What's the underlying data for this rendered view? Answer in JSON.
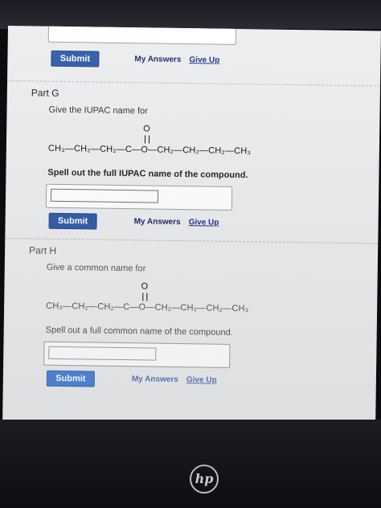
{
  "top": {
    "submit_label": "Submit",
    "my_answers_label": "My Answers",
    "give_up_label": "Give Up"
  },
  "part_g": {
    "title": "Part G",
    "prompt": "Give the IUPAC name for",
    "carbonyl": "O",
    "formula": "CH₃—CH₂—CH₂—C—O—CH₂—CH₂—CH₂—CH₃",
    "instruction": "Spell out the full IUPAC name of the compound.",
    "answer_value": "",
    "submit_label": "Submit",
    "my_answers_label": "My Answers",
    "give_up_label": "Give Up"
  },
  "part_h": {
    "title": "Part H",
    "prompt": "Give a common name for",
    "carbonyl": "O",
    "formula": "CH₃—CH₂—CH₂—C—O—CH₂—CH₂—CH₂—CH₃",
    "instruction": "Spell out a full common name of the compound.",
    "answer_value": "",
    "submit_label": "Submit",
    "my_answers_label": "My Answers",
    "give_up_label": "Give Up"
  },
  "device": {
    "logo": "hp"
  }
}
